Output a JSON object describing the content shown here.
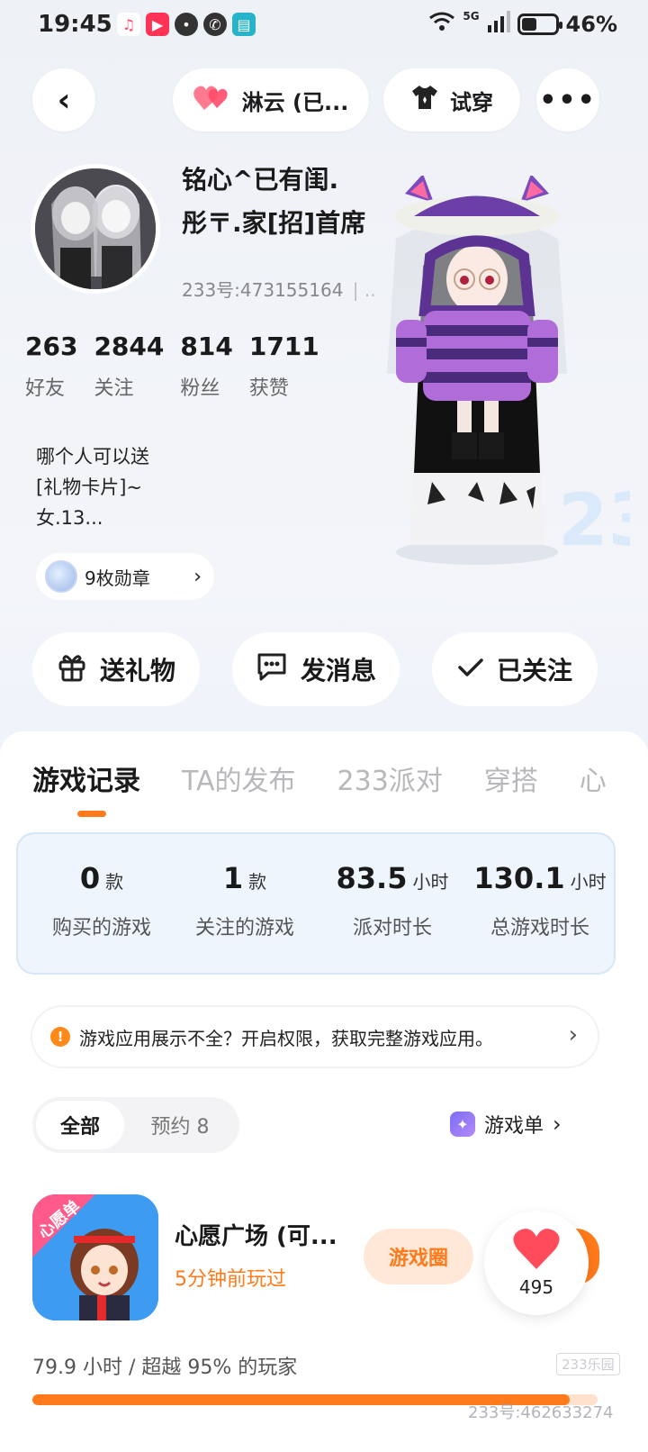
{
  "status_bar": {
    "time": "19:45",
    "network": "5G",
    "battery_percent": "46%",
    "battery_level": 0.46
  },
  "top_nav": {
    "partner_name": "淋云 (已...",
    "try_on_label": "试穿"
  },
  "profile": {
    "nickname_line1": "铭心^已有闺.",
    "nickname_line2": "彤〒.家[招]首席",
    "uid": "233号:473155164",
    "stats": [
      {
        "value": "263",
        "label": "好友"
      },
      {
        "value": "2844",
        "label": "关注"
      },
      {
        "value": "814",
        "label": "粉丝"
      },
      {
        "value": "1711",
        "label": "获赞"
      }
    ],
    "bio_lines": [
      "哪个人可以送",
      "[礼物卡片]~",
      "女.13..."
    ],
    "badges_label": "9枚勋章"
  },
  "actions": {
    "gift_label": "送礼物",
    "message_label": "发消息",
    "follow_label": "已关注"
  },
  "tabs": [
    {
      "label": "游戏记录",
      "active": true
    },
    {
      "label": "TA的发布",
      "active": false
    },
    {
      "label": "233派对",
      "active": false
    },
    {
      "label": "穿搭",
      "active": false
    },
    {
      "label": "心",
      "active": false
    }
  ],
  "game_stats": [
    {
      "value": "0",
      "unit": "款",
      "label": "购买的游戏"
    },
    {
      "value": "1",
      "unit": "款",
      "label": "关注的游戏"
    },
    {
      "value": "83.5",
      "unit": "小时",
      "label": "派对时长"
    },
    {
      "value": "130.1",
      "unit": "小时",
      "label": "总游戏时长"
    }
  ],
  "notice": {
    "text": "游戏应用展示不全？开启权限，获取完整游戏应用。"
  },
  "filter": {
    "all_label": "全部",
    "reserve_label": "预约 8",
    "game_list_label": "游戏单"
  },
  "game": {
    "title": "心愿广场 (可...",
    "played": "5分钟前玩过",
    "circle_label": "游戏圈",
    "icon_tag": "心愿单",
    "like_count": "495",
    "progress_text": "79.9 小时 / 超越 95% 的玩家",
    "progress_percent": 95
  },
  "watermark": {
    "logo": "233乐园",
    "text": "233号:462633274"
  },
  "colors": {
    "accent": "#ff7a1a",
    "stats_card_bg": "#eef5fd",
    "heart": "#ff4b5c"
  }
}
